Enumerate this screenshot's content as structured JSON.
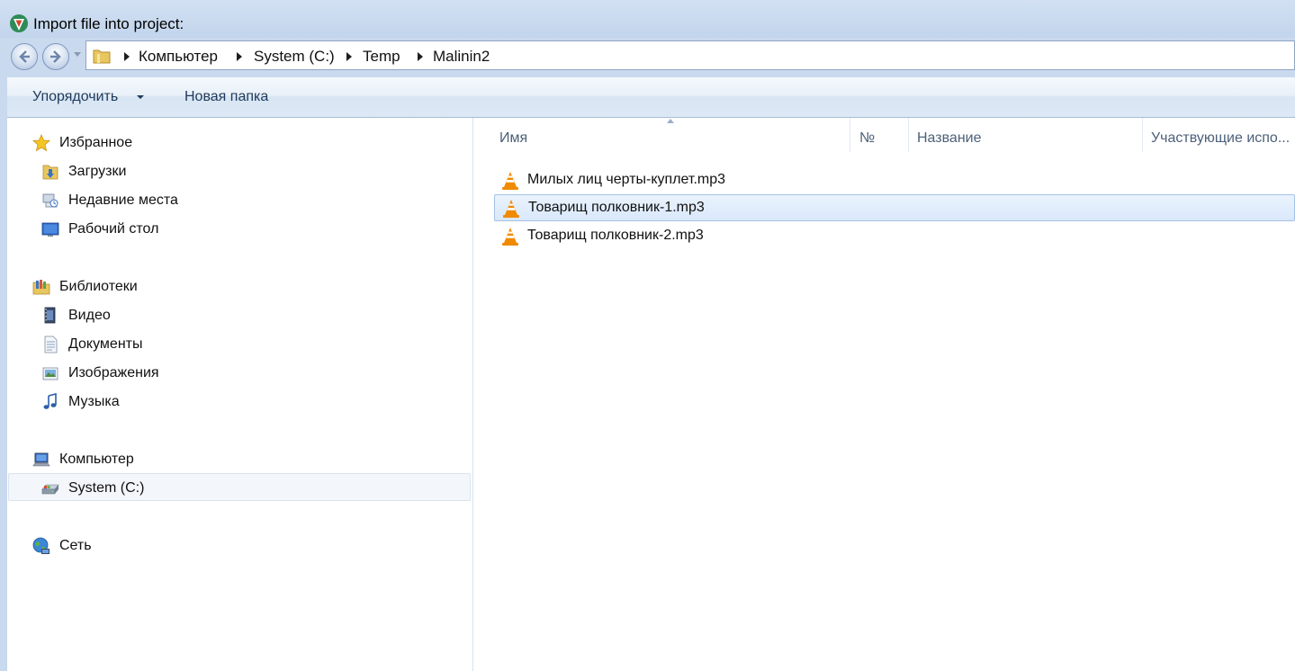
{
  "window": {
    "title": "Import file into project:"
  },
  "address": {
    "crumbs": [
      "Компьютер",
      "System (C:)",
      "Temp",
      "Malinin2"
    ]
  },
  "toolbar": {
    "organize_label": "Упорядочить",
    "new_folder_label": "Новая папка"
  },
  "navigation": {
    "favorites": {
      "label": "Избранное",
      "items": [
        {
          "label": "Загрузки",
          "icon": "downloads-folder-icon"
        },
        {
          "label": "Недавние места",
          "icon": "recent-places-icon"
        },
        {
          "label": "Рабочий стол",
          "icon": "desktop-icon"
        }
      ]
    },
    "libraries": {
      "label": "Библиотеки",
      "items": [
        {
          "label": "Видео",
          "icon": "video-library-icon"
        },
        {
          "label": "Документы",
          "icon": "documents-library-icon"
        },
        {
          "label": "Изображения",
          "icon": "pictures-library-icon"
        },
        {
          "label": "Музыка",
          "icon": "music-library-icon"
        }
      ]
    },
    "computer": {
      "label": "Компьютер",
      "items": [
        {
          "label": "System (C:)",
          "icon": "drive-icon",
          "selected": true
        }
      ]
    },
    "network": {
      "label": "Сеть"
    }
  },
  "file_list": {
    "columns": [
      "Имя",
      "№",
      "Название",
      "Участвующие испо..."
    ],
    "files": [
      {
        "name": "Милых лиц черты-куплет.mp3",
        "icon": "vlc-file-icon",
        "selected": false
      },
      {
        "name": "Товарищ полковник-1.mp3",
        "icon": "vlc-file-icon",
        "selected": true
      },
      {
        "name": "Товарищ полковник-2.mp3",
        "icon": "vlc-file-icon",
        "selected": false
      }
    ]
  },
  "colors": {
    "accent": "#1e395b",
    "selection": "#d9e8fb",
    "vlc_orange": "#f08a00"
  }
}
